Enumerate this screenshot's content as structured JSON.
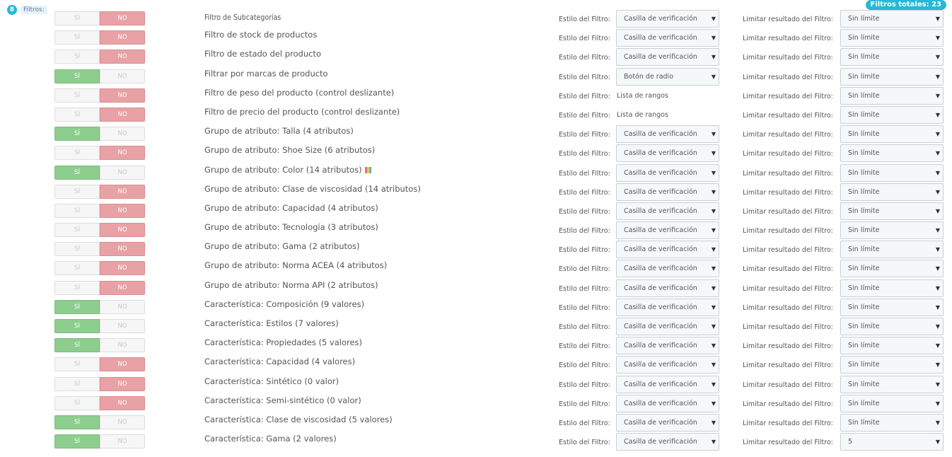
{
  "header": {
    "count_badge": "8",
    "filters_label": "Filtros:",
    "total_badge": "Filtros totales: 23"
  },
  "labels": {
    "yes": "SÍ",
    "no": "NO",
    "style_label": "Estilo del Filtro:",
    "limit_label": "Limitar resultado del Filtro:"
  },
  "rows": [
    {
      "name": "Filtro de Subcategorías",
      "enabled": false,
      "style": "Casilla de verificación",
      "style_is_select": true,
      "limit": "Sin límite"
    },
    {
      "name": "Filtro de stock de productos",
      "enabled": false,
      "style": "Casilla de verificación",
      "style_is_select": true,
      "limit": "Sin límite"
    },
    {
      "name": "Filtro de estado del producto",
      "enabled": false,
      "style": "Casilla de verificación",
      "style_is_select": true,
      "limit": "Sin límite"
    },
    {
      "name": "Filtrar por marcas de producto",
      "enabled": true,
      "style": "Botón de radio",
      "style_is_select": true,
      "limit": "Sin límite"
    },
    {
      "name": "Filtro de peso del producto (control deslizante)",
      "enabled": false,
      "style": "Lista de rangos",
      "style_is_select": false,
      "limit": "Sin límite"
    },
    {
      "name": "Filtro de precio del producto (control deslizante)",
      "enabled": false,
      "style": "Lista de rangos",
      "style_is_select": false,
      "limit": "Sin límite"
    },
    {
      "name": "Grupo de atributo: Talla (4 atributos)",
      "enabled": true,
      "style": "Casilla de verificación",
      "style_is_select": true,
      "limit": "Sin límite"
    },
    {
      "name": "Grupo de atributo: Shoe Size (6 atributos)",
      "enabled": false,
      "style": "Casilla de verificación",
      "style_is_select": true,
      "limit": "Sin límite"
    },
    {
      "name": "Grupo de atributo: Color (14 atributos)",
      "enabled": true,
      "style": "Casilla de verificación",
      "style_is_select": true,
      "limit": "Sin límite",
      "color_icon": "color-grid-icon"
    },
    {
      "name": "Grupo de atributo: Clase de viscosidad (14 atributos)",
      "enabled": false,
      "style": "Casilla de verificación",
      "style_is_select": true,
      "limit": "Sin límite"
    },
    {
      "name": "Grupo de atributo: Capacidad (4 atributos)",
      "enabled": false,
      "style": "Casilla de verificación",
      "style_is_select": true,
      "limit": "Sin límite"
    },
    {
      "name": "Grupo de atributo: Tecnología (3 atributos)",
      "enabled": false,
      "style": "Casilla de verificación",
      "style_is_select": true,
      "limit": "Sin límite"
    },
    {
      "name": "Grupo de atributo: Gama (2 atributos)",
      "enabled": false,
      "style": "Casilla de verificación",
      "style_is_select": true,
      "limit": "Sin límite"
    },
    {
      "name": "Grupo de atributo: Norma ACEA (4 atributos)",
      "enabled": false,
      "style": "Casilla de verificación",
      "style_is_select": true,
      "limit": "Sin límite"
    },
    {
      "name": "Grupo de atributo: Norma API (2 atributos)",
      "enabled": false,
      "style": "Casilla de verificación",
      "style_is_select": true,
      "limit": "Sin límite"
    },
    {
      "name": "Característica: Composición (9 valores)",
      "enabled": true,
      "style": "Casilla de verificación",
      "style_is_select": true,
      "limit": "Sin límite"
    },
    {
      "name": "Característica: Estilos (7 valores)",
      "enabled": true,
      "style": "Casilla de verificación",
      "style_is_select": true,
      "limit": "Sin límite"
    },
    {
      "name": "Característica: Propiedades (5 valores)",
      "enabled": true,
      "style": "Casilla de verificación",
      "style_is_select": true,
      "limit": "Sin límite"
    },
    {
      "name": "Característica: Capacidad (4 valores)",
      "enabled": false,
      "style": "Casilla de verificación",
      "style_is_select": true,
      "limit": "Sin límite"
    },
    {
      "name": "Característica: Sintético (0 valor)",
      "enabled": false,
      "style": "Casilla de verificación",
      "style_is_select": true,
      "limit": "Sin límite"
    },
    {
      "name": "Característica: Semi-sintético (0 valor)",
      "enabled": false,
      "style": "Casilla de verificación",
      "style_is_select": true,
      "limit": "Sin límite"
    },
    {
      "name": "Característica: Clase de viscosidad (5 valores)",
      "enabled": true,
      "style": "Casilla de verificación",
      "style_is_select": true,
      "limit": "Sin límite"
    },
    {
      "name": "Característica: Gama (2 valores)",
      "enabled": true,
      "style": "Casilla de verificación",
      "style_is_select": true,
      "limit": "5"
    }
  ]
}
